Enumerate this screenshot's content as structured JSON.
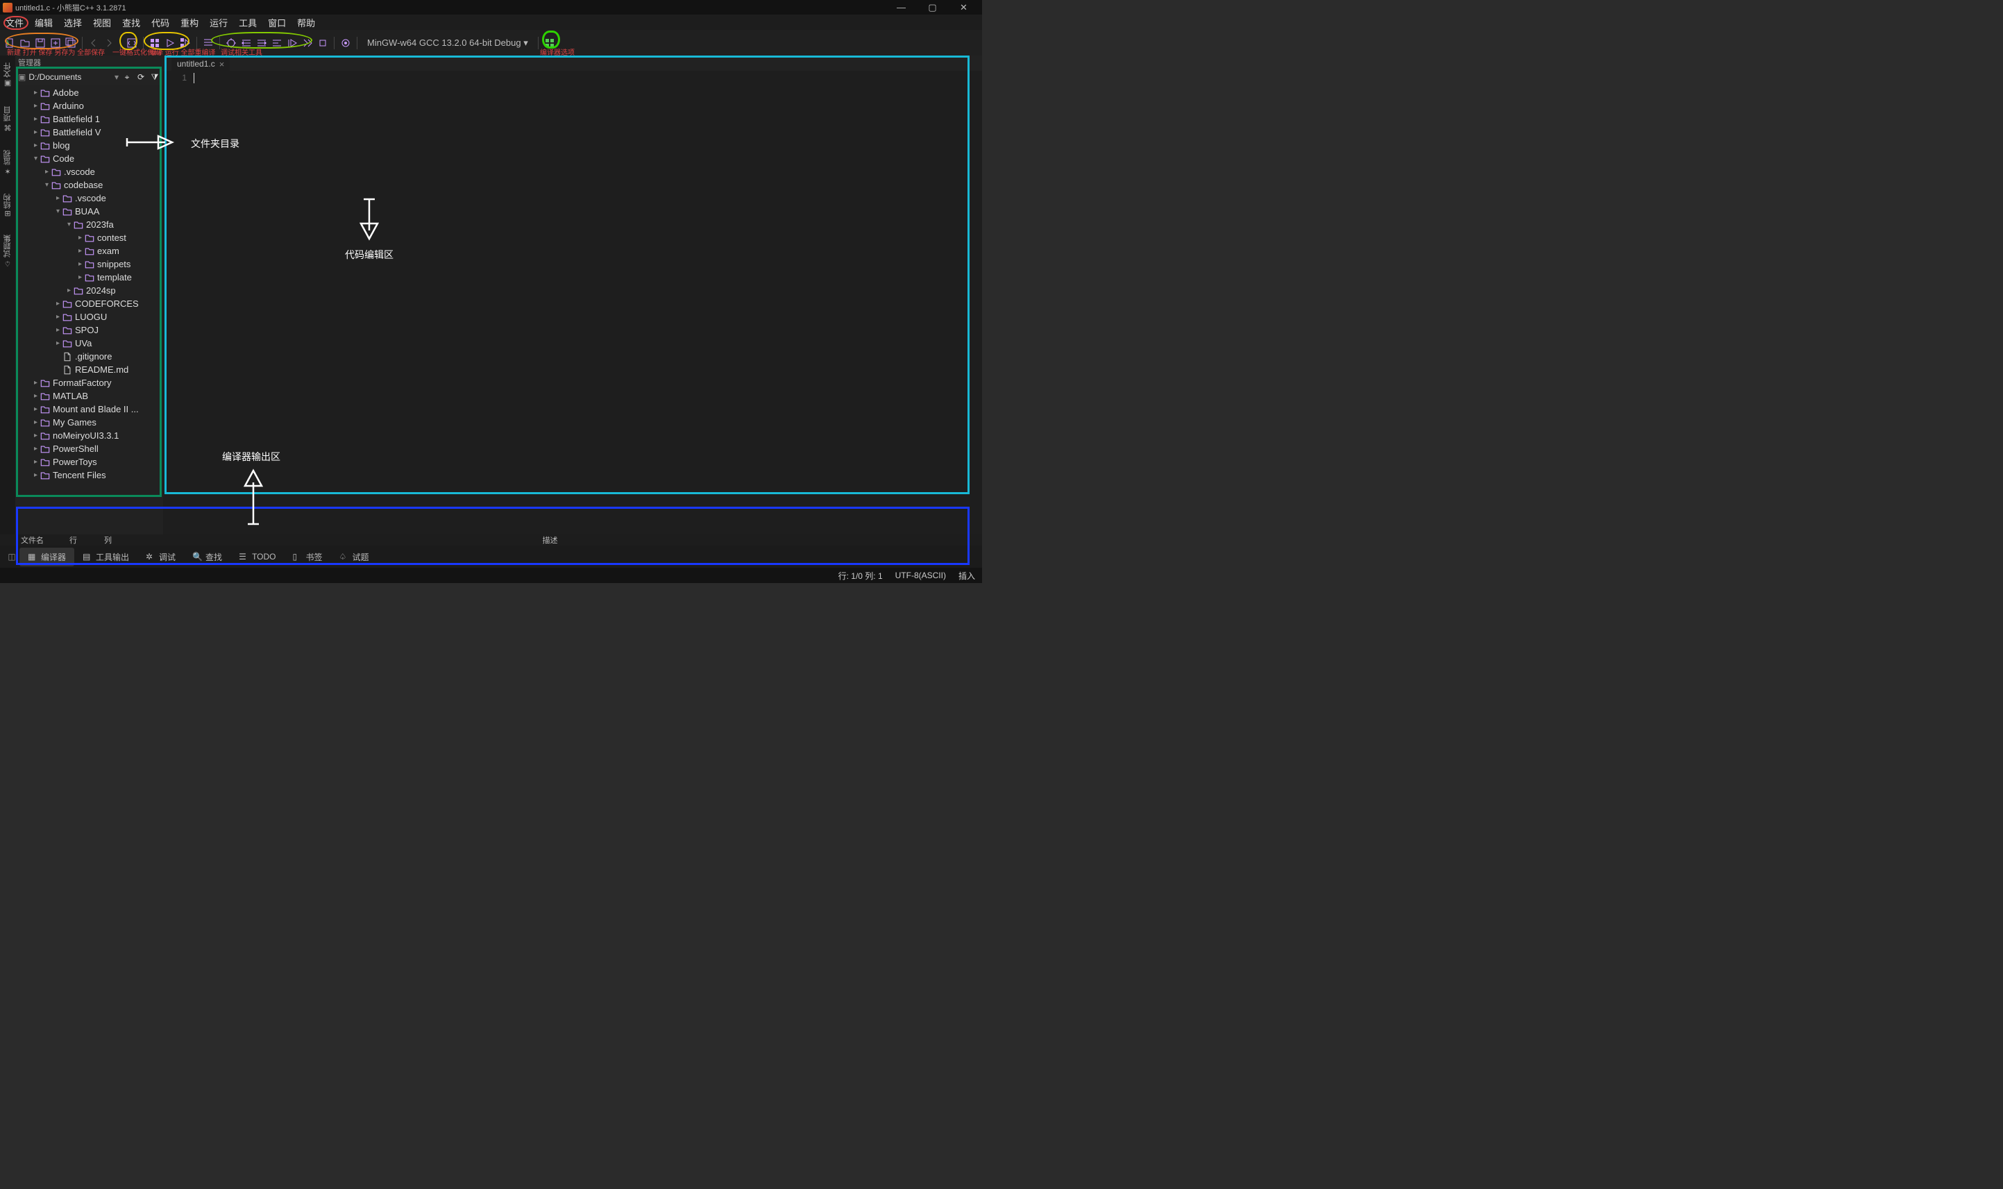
{
  "title": "untitled1.c - 小熊猫C++ 3.1.2871",
  "menu": [
    "文件",
    "编辑",
    "选择",
    "视图",
    "查找",
    "代码",
    "重构",
    "运行",
    "工具",
    "窗口",
    "帮助"
  ],
  "tb_labels": {
    "file": "新建 打开 保存 另存为 全部保存",
    "fmt": "一键格式化代码",
    "run": "编译 运行 全部重编译",
    "dbg": "调试相关工具",
    "opt": "编译器选项"
  },
  "compiler": "MinGW-w64 GCC 13.2.0 64-bit Debug",
  "panel_title": "管理器",
  "leftbar": [
    "文件",
    "项目",
    "监视",
    "结构",
    "试题集"
  ],
  "tree_root": "D:/Documents",
  "tree": [
    {
      "d": 1,
      "t": "▸",
      "n": "Adobe",
      "k": "folder"
    },
    {
      "d": 1,
      "t": "▸",
      "n": "Arduino",
      "k": "folder"
    },
    {
      "d": 1,
      "t": "▸",
      "n": "Battlefield 1",
      "k": "folder"
    },
    {
      "d": 1,
      "t": "▸",
      "n": "Battlefield V",
      "k": "folder"
    },
    {
      "d": 1,
      "t": "▸",
      "n": "blog",
      "k": "folder"
    },
    {
      "d": 1,
      "t": "▾",
      "n": "Code",
      "k": "folder"
    },
    {
      "d": 2,
      "t": "▸",
      "n": ".vscode",
      "k": "folder"
    },
    {
      "d": 2,
      "t": "▾",
      "n": "codebase",
      "k": "folder"
    },
    {
      "d": 3,
      "t": "▸",
      "n": ".vscode",
      "k": "folder"
    },
    {
      "d": 3,
      "t": "▾",
      "n": "BUAA",
      "k": "folder"
    },
    {
      "d": 4,
      "t": "▾",
      "n": "2023fa",
      "k": "folder"
    },
    {
      "d": 5,
      "t": "▸",
      "n": "contest",
      "k": "folder"
    },
    {
      "d": 5,
      "t": "▸",
      "n": "exam",
      "k": "folder"
    },
    {
      "d": 5,
      "t": "▸",
      "n": "snippets",
      "k": "folder"
    },
    {
      "d": 5,
      "t": "▸",
      "n": "template",
      "k": "folder"
    },
    {
      "d": 4,
      "t": "▸",
      "n": "2024sp",
      "k": "folder"
    },
    {
      "d": 3,
      "t": "▸",
      "n": "CODEFORCES",
      "k": "folder"
    },
    {
      "d": 3,
      "t": "▸",
      "n": "LUOGU",
      "k": "folder"
    },
    {
      "d": 3,
      "t": "▸",
      "n": "SPOJ",
      "k": "folder"
    },
    {
      "d": 3,
      "t": "▸",
      "n": "UVa",
      "k": "folder"
    },
    {
      "d": 3,
      "t": "",
      "n": ".gitignore",
      "k": "file"
    },
    {
      "d": 3,
      "t": "",
      "n": "README.md",
      "k": "file"
    },
    {
      "d": 1,
      "t": "▸",
      "n": "FormatFactory",
      "k": "folder"
    },
    {
      "d": 1,
      "t": "▸",
      "n": "MATLAB",
      "k": "folder"
    },
    {
      "d": 1,
      "t": "▸",
      "n": "Mount and Blade II ...",
      "k": "folder"
    },
    {
      "d": 1,
      "t": "▸",
      "n": "My Games",
      "k": "folder"
    },
    {
      "d": 1,
      "t": "▸",
      "n": "noMeiryoUI3.3.1",
      "k": "folder"
    },
    {
      "d": 1,
      "t": "▸",
      "n": "PowerShell",
      "k": "folder"
    },
    {
      "d": 1,
      "t": "▸",
      "n": "PowerToys",
      "k": "folder"
    },
    {
      "d": 1,
      "t": "▸",
      "n": "Tencent Files",
      "k": "folder"
    }
  ],
  "tab": {
    "name": "untitled1.c"
  },
  "gutter": "1",
  "issues": {
    "c1": "文件名",
    "c2": "行",
    "c3": "列",
    "desc": "描述"
  },
  "bottom_tabs": [
    "编译器",
    "工具输出",
    "调试",
    "查找",
    "TODO",
    "书签",
    "试题"
  ],
  "status": {
    "pos": "行: 1/0 列: 1",
    "enc": "UTF-8(ASCII)",
    "mode": "插入"
  },
  "ann": {
    "folder": "文件夹目录",
    "editor": "代码编辑区",
    "output": "编译器输出区"
  }
}
